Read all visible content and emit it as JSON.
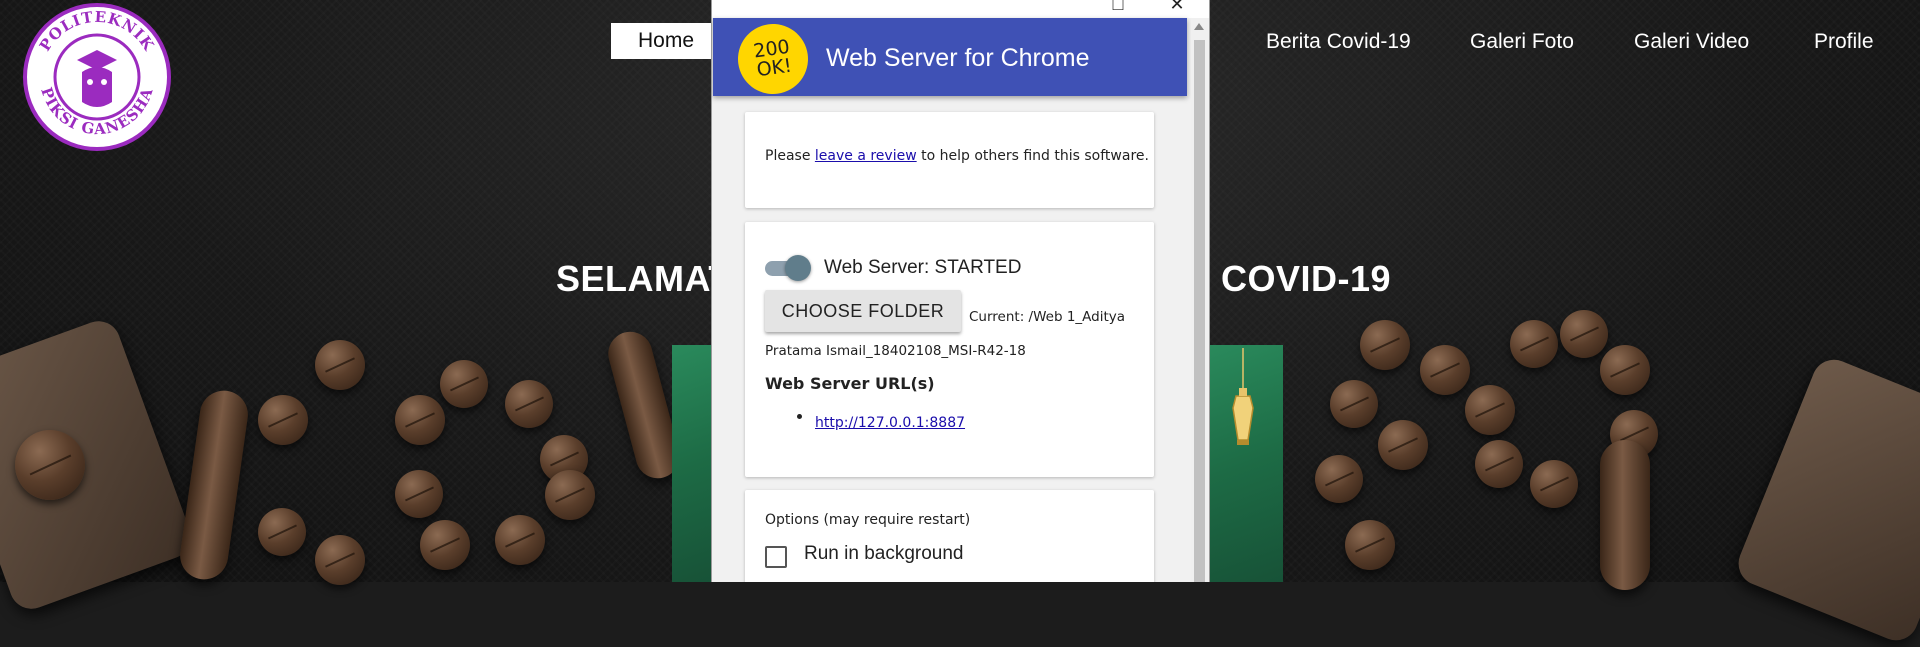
{
  "site": {
    "logo_top_text": "POLITEKNIK",
    "logo_bottom_text": "PIKSI GANESHA",
    "nav": [
      "Home",
      "Berita Covid-19",
      "Galeri Foto",
      "Galeri Video",
      "Profile"
    ],
    "hero_left": "SELAMAT",
    "hero_right": "COVID-19",
    "colors": {
      "logo_purple": "#9b2bbf",
      "background": "#1c1c1c"
    }
  },
  "window": {
    "title": "Web Server for Chrome",
    "icon_line1": "200",
    "icon_line2": "OK!",
    "maximize_icon": "□",
    "close_icon": "✕",
    "colors": {
      "appbar": "#3f51b5",
      "icon_bg": "#ffd600"
    }
  },
  "review": {
    "prefix": "Please ",
    "link": "leave a review",
    "suffix": " to help others find this software."
  },
  "server": {
    "status": "Web Server: STARTED",
    "toggle_on": true,
    "choose_button": "CHOOSE FOLDER",
    "current_path": "Current: /Web 1_Aditya Pratama Ismail_18402108_MSI-R42-18",
    "urls_heading": "Web Server URL(s)",
    "urls": [
      "http://127.0.0.1:8887"
    ]
  },
  "options": {
    "heading": "Options (may require restart)",
    "run_in_background": "Run in background",
    "run_in_background_checked": false
  }
}
